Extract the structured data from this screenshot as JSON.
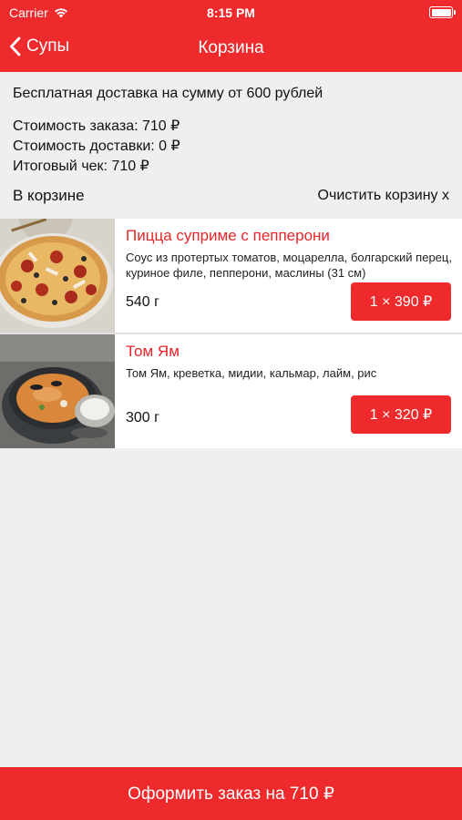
{
  "status_bar": {
    "carrier": "Carrier",
    "time": "8:15 PM"
  },
  "nav": {
    "back_label": "Супы",
    "title": "Корзина"
  },
  "info": {
    "promo": "Бесплатная доставка на сумму от 600 рублей",
    "order_cost": "Стоимость заказа: 710 ₽",
    "delivery_cost": "Стоимость доставки: 0 ₽",
    "total": "Итоговый чек: 710 ₽"
  },
  "cart": {
    "label": "В корзине",
    "clear_label": "Очистить корзину x"
  },
  "items": [
    {
      "name": "Пицца суприме с пепперони",
      "description": "Соус из протертых томатов, моцарелла, болгарский перец, куриное филе, пепперони, маслины (31 см)",
      "weight": "540 г",
      "price_button": "1 × 390 ₽"
    },
    {
      "name": "Том Ям",
      "description": "Том Ям, креветка, мидии, кальмар, лайм, рис",
      "weight": "300 г",
      "price_button": "1 × 320 ₽"
    }
  ],
  "checkout": {
    "label": "Оформить заказ на 710 ₽"
  },
  "colors": {
    "accent": "#ee2a2c",
    "item_name": "#e8262a",
    "background": "#efefef"
  }
}
